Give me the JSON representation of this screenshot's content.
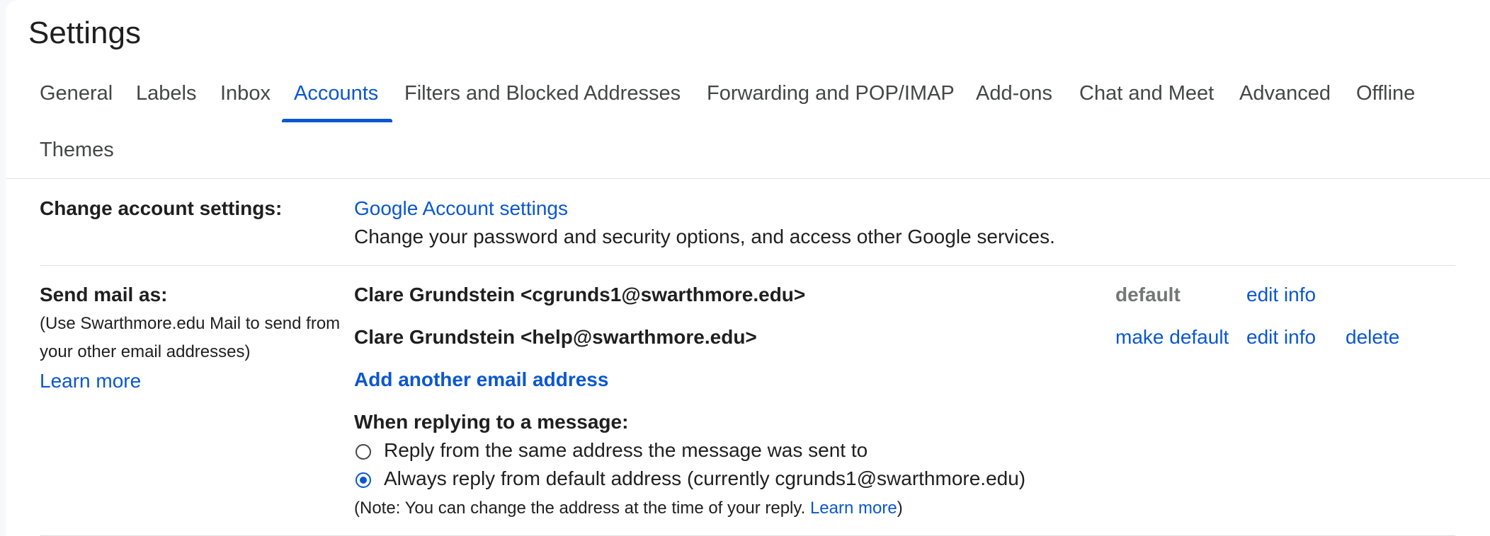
{
  "page": {
    "title": "Settings"
  },
  "tabs": [
    {
      "label": "General"
    },
    {
      "label": "Labels"
    },
    {
      "label": "Inbox"
    },
    {
      "label": "Accounts"
    },
    {
      "label": "Filters and Blocked Addresses"
    },
    {
      "label": "Forwarding and POP/IMAP"
    },
    {
      "label": "Add-ons"
    },
    {
      "label": "Chat and Meet"
    },
    {
      "label": "Advanced"
    },
    {
      "label": "Offline"
    },
    {
      "label": "Themes"
    }
  ],
  "active_tab": "Accounts",
  "change_account": {
    "label": "Change account settings:",
    "link": "Google Account settings",
    "description": "Change your password and security options, and access other Google services."
  },
  "send_mail_as": {
    "label": "Send mail as:",
    "help_line1": "(Use Swarthmore.edu Mail to send from",
    "help_line2": "your other email addresses)",
    "learn_more": "Learn more",
    "addresses": [
      {
        "address": "Clare Grundstein <cgrunds1@swarthmore.edu>",
        "status": "default",
        "edit": "edit info"
      },
      {
        "address": "Clare Grundstein <help@swarthmore.edu>",
        "make_default": "make default",
        "edit": "edit info",
        "delete": "delete"
      }
    ],
    "add_another": "Add another email address",
    "reply_heading": "When replying to a message:",
    "reply_options": [
      {
        "label": "Reply from the same address the message was sent to",
        "checked": false
      },
      {
        "label": "Always reply from default address (currently cgrunds1@swarthmore.edu)",
        "checked": true
      }
    ],
    "note_prefix": "(Note: You can change the address at the time of your reply. ",
    "note_link": "Learn more",
    "note_suffix": ")"
  },
  "colors": {
    "accent": "#0b57d0",
    "text": "#1f1f1f",
    "muted": "#747775",
    "tab_text": "#444746"
  }
}
